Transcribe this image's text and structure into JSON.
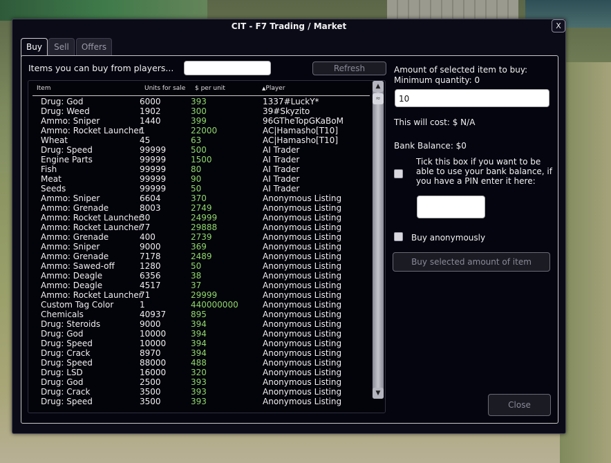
{
  "window": {
    "title": "CIT - F7 Trading / Market",
    "close_label": "X"
  },
  "tabs": [
    {
      "label": "Buy",
      "active": true
    },
    {
      "label": "Sell",
      "active": false
    },
    {
      "label": "Offers",
      "active": false
    }
  ],
  "search": {
    "label": "Items you can buy from players...",
    "value": "",
    "refresh_label": "Refresh"
  },
  "list": {
    "headers": {
      "item": "Item",
      "units": "Units for sale",
      "price": "$ per unit",
      "player": "Player",
      "player_sort_indicator": "▲"
    },
    "rows": [
      {
        "item": "Drug: God",
        "units": "6000",
        "price": "393",
        "player": "1337#LuckY*"
      },
      {
        "item": "Drug: Weed",
        "units": "1902",
        "price": "300",
        "player": "39#Skyzito"
      },
      {
        "item": "Ammo: Sniper",
        "units": "1440",
        "price": "399",
        "player": "96GTheTopGKaBoM"
      },
      {
        "item": "Ammo: Rocket Launcher",
        "units": "1",
        "price": "22000",
        "player": "AC|Hamasho[T10]"
      },
      {
        "item": "Wheat",
        "units": "45",
        "price": "63",
        "player": "AC|Hamasho[T10]"
      },
      {
        "item": "Drug: Speed",
        "units": "99999",
        "price": "500",
        "player": "AI Trader"
      },
      {
        "item": "Engine Parts",
        "units": "99999",
        "price": "1500",
        "player": "AI Trader"
      },
      {
        "item": "Fish",
        "units": "99999",
        "price": "80",
        "player": "AI Trader"
      },
      {
        "item": "Meat",
        "units": "99999",
        "price": "90",
        "player": "AI Trader"
      },
      {
        "item": "Seeds",
        "units": "99999",
        "price": "50",
        "player": "AI Trader"
      },
      {
        "item": "Ammo: Sniper",
        "units": "6604",
        "price": "370",
        "player": "Anonymous Listing"
      },
      {
        "item": "Ammo: Grenade",
        "units": "8003",
        "price": "2749",
        "player": "Anonymous Listing"
      },
      {
        "item": "Ammo: Rocket Launcher",
        "units": "30",
        "price": "24999",
        "player": "Anonymous Listing"
      },
      {
        "item": "Ammo: Rocket Launcher H",
        "units": "77",
        "price": "29888",
        "player": "Anonymous Listing"
      },
      {
        "item": "Ammo: Grenade",
        "units": "400",
        "price": "2739",
        "player": "Anonymous Listing"
      },
      {
        "item": "Ammo: Sniper",
        "units": "9000",
        "price": "369",
        "player": "Anonymous Listing"
      },
      {
        "item": "Ammo: Grenade",
        "units": "7178",
        "price": "2489",
        "player": "Anonymous Listing"
      },
      {
        "item": "Ammo: Sawed-off",
        "units": "1280",
        "price": "50",
        "player": "Anonymous Listing"
      },
      {
        "item": "Ammo: Deagle",
        "units": "6356",
        "price": "38",
        "player": "Anonymous Listing"
      },
      {
        "item": "Ammo: Deagle",
        "units": "4517",
        "price": "37",
        "player": "Anonymous Listing"
      },
      {
        "item": "Ammo: Rocket Launcher",
        "units": "71",
        "price": "29999",
        "player": "Anonymous Listing"
      },
      {
        "item": "Custom Tag Color",
        "units": "1",
        "price": "440000000",
        "player": "Anonymous Listing"
      },
      {
        "item": "Chemicals",
        "units": "40937",
        "price": "895",
        "player": "Anonymous Listing"
      },
      {
        "item": "Drug: Steroids",
        "units": "9000",
        "price": "394",
        "player": "Anonymous Listing"
      },
      {
        "item": "Drug: God",
        "units": "10000",
        "price": "394",
        "player": "Anonymous Listing"
      },
      {
        "item": "Drug: Speed",
        "units": "10000",
        "price": "394",
        "player": "Anonymous Listing"
      },
      {
        "item": "Drug: Crack",
        "units": "8970",
        "price": "394",
        "player": "Anonymous Listing"
      },
      {
        "item": "Drug: Speed",
        "units": "88000",
        "price": "488",
        "player": "Anonymous Listing"
      },
      {
        "item": "Drug: LSD",
        "units": "16000",
        "price": "320",
        "player": "Anonymous Listing"
      },
      {
        "item": "Drug: God",
        "units": "2500",
        "price": "393",
        "player": "Anonymous Listing"
      },
      {
        "item": "Drug: Crack",
        "units": "3500",
        "price": "393",
        "player": "Anonymous Listing"
      },
      {
        "item": "Drug: Speed",
        "units": "3500",
        "price": "393",
        "player": "Anonymous Listing"
      }
    ]
  },
  "buy_panel": {
    "amount_label": "Amount of selected item to buy:",
    "min_qty_label": "Minimum quantity: 0",
    "amount_value": "10",
    "cost_label": "This will cost: $ N/A",
    "bank_balance_label": "Bank Balance: $0",
    "bank_checkbox_label": "Tick this box if you want to be able to use your bank balance, if you have a PIN enter it here:",
    "bank_checkbox_checked": false,
    "pin_value": "",
    "anonymous_label": "Buy anonymously",
    "anonymous_checked": false,
    "buy_button_label": "Buy selected amount of item",
    "close_button_label": "Close"
  },
  "colors": {
    "price_green": "#8fd86a",
    "window_bg": "#0b0b18",
    "text": "#f2f2f2"
  }
}
